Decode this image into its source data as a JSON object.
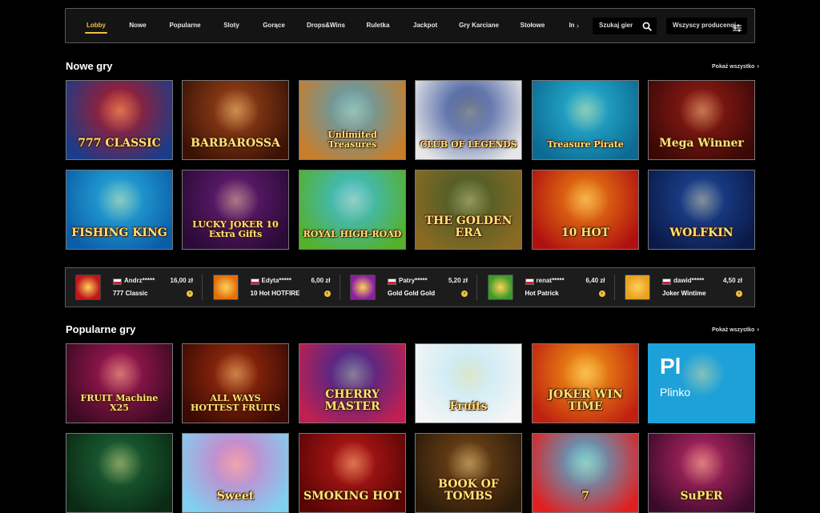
{
  "nav": {
    "tabs": [
      "Lobby",
      "Nowe",
      "Popularne",
      "Sloty",
      "Gorące",
      "Drops&Wins",
      "Ruletka",
      "Jackpot",
      "Gry Karciane",
      "Stołowe",
      "In"
    ],
    "more_icon": "chevron-right-icon",
    "search_placeholder": "Szukaj gier",
    "providers_label": "Wszyscy producenci"
  },
  "new_games": {
    "title": "Nowe gry",
    "show_all": "Pokaż wszystko",
    "games": [
      {
        "name": "777 CLASSIC",
        "bg1": "#c0151a",
        "bg2": "#1a3c8a"
      },
      {
        "name": "BARBAROSSA",
        "bg1": "#a4471a",
        "bg2": "#3a1206"
      },
      {
        "name": "Unlimited Treasures",
        "bg1": "#4aa3c9",
        "bg2": "#c87d2a"
      },
      {
        "name": "CLUB OF LEGENDS",
        "bg1": "#1c3a8f",
        "bg2": "#e7e7e7"
      },
      {
        "name": "Treasure Pirate",
        "bg1": "#2ab8d8",
        "bg2": "#0c6a93"
      },
      {
        "name": "Mega Winner",
        "bg1": "#9a1d17",
        "bg2": "#3a0906"
      },
      {
        "name": "FISHING KING",
        "bg1": "#2bb3e0",
        "bg2": "#0a5da8"
      },
      {
        "name": "LUCKY JOKER 10 Extra Gifts",
        "bg1": "#6a1f7a",
        "bg2": "#2a0a36"
      },
      {
        "name": "ROYAL HIGH-ROAD",
        "bg1": "#3bbde8",
        "bg2": "#55b02a"
      },
      {
        "name": "THE GOLDEN ERA",
        "bg1": "#3d5a2a",
        "bg2": "#8a6a22"
      },
      {
        "name": "10 HOT",
        "bg1": "#f08a12",
        "bg2": "#b01010"
      },
      {
        "name": "WOLFKIN",
        "bg1": "#1f4aa0",
        "bg2": "#0a1a48"
      }
    ]
  },
  "wins": [
    {
      "user": "Andrz*****",
      "amount": "16,00 zł",
      "game": "777 Classic",
      "thumb": "#c0151a"
    },
    {
      "user": "Edyta*****",
      "amount": "6,00 zł",
      "game": "10 Hot HOTFIRE",
      "thumb": "#e0700f"
    },
    {
      "user": "Patry*****",
      "amount": "5,20 zł",
      "game": "Gold Gold Gold",
      "thumb": "#8a1fa0"
    },
    {
      "user": "renat*****",
      "amount": "6,40 zł",
      "game": "Hot Patrick",
      "thumb": "#3a9a2a"
    },
    {
      "user": "dawid*****",
      "amount": "4,50 zł",
      "game": "Joker Wintime",
      "thumb": "#e8a020"
    }
  ],
  "popular_games": {
    "title": "Popularne gry",
    "show_all": "Pokaż wszystko",
    "games": [
      {
        "name": "FRUIT Machine X25",
        "bg1": "#b01a5a",
        "bg2": "#3a0a22"
      },
      {
        "name": "ALL WAYS HOTTEST FRUITS",
        "bg1": "#a6300e",
        "bg2": "#3a0a04"
      },
      {
        "name": "CHERRY MASTER",
        "bg1": "#2a2a9a",
        "bg2": "#c02050"
      },
      {
        "name": "Fruits",
        "bg1": "#bfe8f5",
        "bg2": "#f5f5f5"
      },
      {
        "name": "JOKER WIN TIME",
        "bg1": "#f5a215",
        "bg2": "#c02010"
      },
      {
        "name": "Plinko",
        "bg1": "#1da1d8",
        "bg2": "#1da1d8",
        "short": "Pl"
      },
      {
        "name": "",
        "bg1": "#1f6a3a",
        "bg2": "#0a2a14"
      },
      {
        "name": "Sweet",
        "bg1": "#e070c0",
        "bg2": "#80d0f0"
      },
      {
        "name": "SMOKING HOT",
        "bg1": "#c01a1a",
        "bg2": "#5a0505"
      },
      {
        "name": "BOOK OF TOMBS",
        "bg1": "#7a4a1a",
        "bg2": "#2a1a0a"
      },
      {
        "name": "7",
        "bg1": "#3bbde8",
        "bg2": "#e02020"
      },
      {
        "name": "SuPER",
        "bg1": "#c02a6a",
        "bg2": "#3a0a2a"
      }
    ]
  }
}
